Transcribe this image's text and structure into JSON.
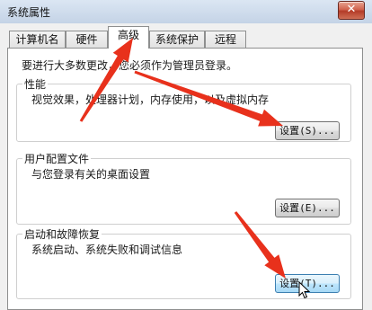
{
  "window": {
    "title": "系统属性",
    "close_glyph": "✕"
  },
  "tabs": [
    {
      "label": "计算机名"
    },
    {
      "label": "硬件"
    },
    {
      "label": "高级",
      "active": true
    },
    {
      "label": "系统保护"
    },
    {
      "label": "远程"
    }
  ],
  "info_text": "要进行大多数更改，您必须作为管理员登录。",
  "performance": {
    "title": "性能",
    "description": "视觉效果，处理器计划，内存使用，以及虚拟内存",
    "button": "设置(S)..."
  },
  "user_profiles": {
    "title": "用户配置文件",
    "description": "与您登录有关的桌面设置",
    "button": "设置(E)..."
  },
  "startup_recovery": {
    "title": "启动和故障恢复",
    "description": "系统启动、系统失败和调试信息",
    "button": "设置(T)..."
  },
  "annotations": {
    "arrow_color": "#e8311c",
    "arrow_count": 3
  },
  "icons": {
    "close": "close-icon",
    "cursor": "mouse-pointer-icon"
  }
}
